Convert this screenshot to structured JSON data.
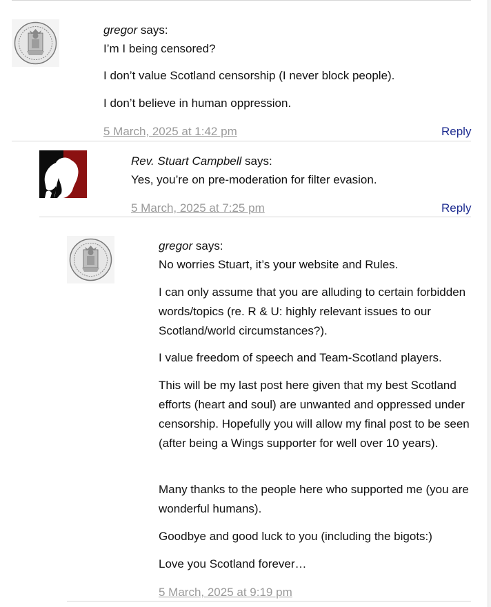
{
  "comments": [
    {
      "author": "gregor",
      "says": "says:",
      "paragraphs": [
        "I’m I being censored?",
        "I don’t value Scotland censorship (I never block people).",
        "I don’t believe in human oppression."
      ],
      "date": "5 March, 2025 at 1:42 pm",
      "reply": "Reply",
      "avatar_icon": "royal-seal-icon"
    },
    {
      "author": "Rev. Stuart Campbell",
      "says": "says:",
      "paragraphs": [
        "Yes, you’re on pre-moderation for filter evasion."
      ],
      "date": "5 March, 2025 at 7:25 pm",
      "reply": "Reply",
      "avatar_icon": "silhouette-figure-icon"
    },
    {
      "author": "gregor",
      "says": "says:",
      "paragraphs": [
        "No worries Stuart, it’s your website and Rules.",
        "I can only assume that you are alluding to certain forbidden words/topics (re. R & U: highly relevant issues to our Scotland/world circumstances?).",
        "I value freedom of speech and Team-Scotland players.",
        "This will be my last post here given that my best Scotland efforts (heart and soul) are unwanted and oppressed under censorship. Hopefully you will allow my final post to be seen (after being a Wings supporter for well over 10 years).",
        "Many thanks to the people here who supported me (you are wonderful humans).",
        "Goodbye and good luck to you (including the bigots:)",
        "Love you Scotland forever…"
      ],
      "date": "5 March, 2025 at 9:19 pm",
      "avatar_icon": "royal-seal-icon"
    }
  ],
  "colors": {
    "link": "#1b2a8f",
    "date": "#9a9a9a",
    "divider": "#d6d6d6",
    "avatar_red": "#8b1111"
  }
}
